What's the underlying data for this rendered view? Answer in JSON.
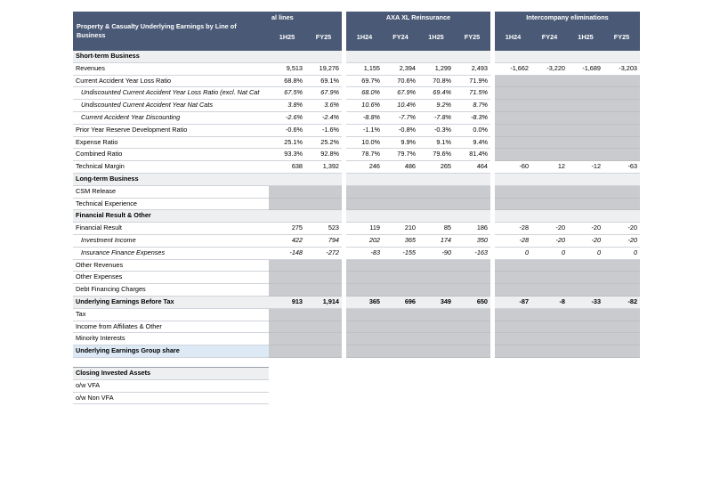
{
  "table": {
    "title": "Property & Casualty Underlying Earnings by Line of Business",
    "groups": [
      "al lines",
      "AXA XL Reinsurance",
      "Intercompany eliminations"
    ],
    "periods": [
      [
        "1H25",
        "FY25"
      ],
      [
        "1H24",
        "FY24",
        "1H25",
        "FY25"
      ],
      [
        "1H24",
        "FY24",
        "1H25",
        "FY25"
      ]
    ],
    "rows": [
      {
        "label": "Short-term Business",
        "style": "section",
        "cells": [
          [],
          [],
          []
        ]
      },
      {
        "label": "Revenues",
        "style": "",
        "cells": [
          [
            "9,513",
            "19,276"
          ],
          [
            "1,155",
            "2,394",
            "1,299",
            "2,493"
          ],
          [
            "-1,662",
            "-3,220",
            "-1,689",
            "-3,203"
          ]
        ]
      },
      {
        "label": "Current Accident Year Loss Ratio",
        "style": "",
        "cells": [
          [
            "68.8%",
            "69.1%"
          ],
          [
            "69.7%",
            "70.6%",
            "70.8%",
            "71.9%"
          ],
          null
        ]
      },
      {
        "label": "Undiscounted Current Accident Year Loss Ratio (excl. Nat Cat",
        "style": "italic",
        "cells": [
          [
            "67.5%",
            "67.9%"
          ],
          [
            "68.0%",
            "67.9%",
            "69.4%",
            "71.5%"
          ],
          null
        ]
      },
      {
        "label": "Undiscounted Current Accident Year Nat Cats",
        "style": "italic",
        "cells": [
          [
            "3.8%",
            "3.6%"
          ],
          [
            "10.6%",
            "10.4%",
            "9.2%",
            "8.7%"
          ],
          null
        ]
      },
      {
        "label": "Current Accident Year Discounting",
        "style": "italic",
        "cells": [
          [
            "-2.6%",
            "-2.4%"
          ],
          [
            "-8.8%",
            "-7.7%",
            "-7.8%",
            "-8.3%"
          ],
          null
        ]
      },
      {
        "label": "Prior Year Reserve Development Ratio",
        "style": "",
        "cells": [
          [
            "-0.6%",
            "-1.6%"
          ],
          [
            "-1.1%",
            "-0.8%",
            "-0.3%",
            "0.0%"
          ],
          null
        ]
      },
      {
        "label": "Expense Ratio",
        "style": "",
        "cells": [
          [
            "25.1%",
            "25.2%"
          ],
          [
            "10.0%",
            "9.9%",
            "9.1%",
            "9.4%"
          ],
          null
        ]
      },
      {
        "label": "Combined Ratio",
        "style": "",
        "cells": [
          [
            "93.3%",
            "92.8%"
          ],
          [
            "78.7%",
            "79.7%",
            "79.6%",
            "81.4%"
          ],
          null
        ]
      },
      {
        "label": "Technical Margin",
        "style": "",
        "cells": [
          [
            "638",
            "1,392"
          ],
          [
            "246",
            "486",
            "265",
            "464"
          ],
          [
            "-60",
            "12",
            "-12",
            "-63"
          ]
        ]
      },
      {
        "label": "Long-term Business",
        "style": "section",
        "cells": [
          [],
          [],
          []
        ]
      },
      {
        "label": "CSM Release",
        "style": "",
        "cells": [
          null,
          null,
          null
        ]
      },
      {
        "label": "Technical Experience",
        "style": "",
        "cells": [
          null,
          null,
          null
        ]
      },
      {
        "label": "Financial Result & Other",
        "style": "section",
        "cells": [
          [],
          [],
          []
        ]
      },
      {
        "label": "Financial Result",
        "style": "",
        "cells": [
          [
            "275",
            "523"
          ],
          [
            "119",
            "210",
            "85",
            "186"
          ],
          [
            "-28",
            "-20",
            "-20",
            "-20"
          ]
        ]
      },
      {
        "label": "Investment Income",
        "style": "italic",
        "cells": [
          [
            "422",
            "794"
          ],
          [
            "202",
            "365",
            "174",
            "350"
          ],
          [
            "-28",
            "-20",
            "-20",
            "-20"
          ]
        ]
      },
      {
        "label": "Insurance Finance Expenses",
        "style": "italic",
        "cells": [
          [
            "-148",
            "-272"
          ],
          [
            "-83",
            "-155",
            "-90",
            "-163"
          ],
          [
            "0",
            "0",
            "0",
            "0"
          ]
        ]
      },
      {
        "label": "Other Revenues",
        "style": "",
        "cells": [
          null,
          null,
          null
        ]
      },
      {
        "label": "Other Expenses",
        "style": "",
        "cells": [
          null,
          null,
          null
        ]
      },
      {
        "label": "Debt Financing Charges",
        "style": "",
        "cells": [
          null,
          null,
          null
        ]
      },
      {
        "label": "Underlying Earnings Before Tax",
        "style": "bold section",
        "cells": [
          [
            "913",
            "1,914"
          ],
          [
            "365",
            "696",
            "349",
            "650"
          ],
          [
            "-87",
            "-8",
            "-33",
            "-82"
          ]
        ]
      },
      {
        "label": "Tax",
        "style": "",
        "cells": [
          null,
          null,
          null
        ]
      },
      {
        "label": "Income from Affiliates & Other",
        "style": "",
        "cells": [
          null,
          null,
          null
        ]
      },
      {
        "label": "Minority Interests",
        "style": "",
        "cells": [
          null,
          null,
          null
        ]
      },
      {
        "label": "Underlying Earnings Group share",
        "style": "highlight",
        "cells": [
          null,
          null,
          null
        ]
      }
    ],
    "assets": [
      {
        "label": "Closing Invested Assets",
        "style": "section topline"
      },
      {
        "label": "o/w VFA",
        "style": ""
      },
      {
        "label": "o/w Non VFA",
        "style": ""
      }
    ]
  }
}
